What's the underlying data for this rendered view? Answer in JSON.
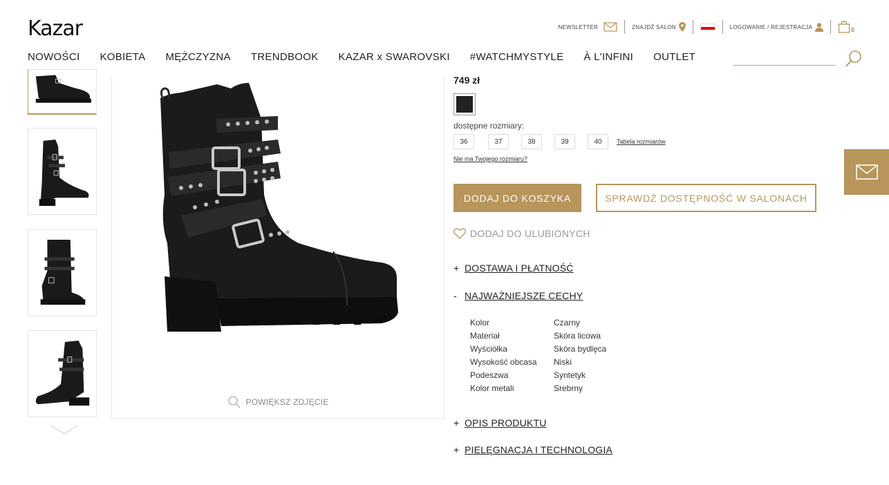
{
  "header": {
    "logo": "Kazar",
    "newsletter": "Newsletter",
    "find_store": "Znajdź salon",
    "login": "Logowanie / Rejestracja",
    "cart_count": "0"
  },
  "nav": {
    "items": [
      "NOWOŚCI",
      "KOBIETA",
      "MĘŻCZYZNA",
      "TRENDBOOK",
      "KAZAR x SWAROVSKI",
      "#WATCHMYSTYLE",
      "À L'INFINI",
      "OUTLET"
    ]
  },
  "gallery": {
    "zoom_label": "POWIĘKSZ ZDJĘCIE"
  },
  "product": {
    "price": "749 zł",
    "color": "#222222",
    "sizes_label": "dostępne rozmiary:",
    "sizes": [
      "36",
      "37",
      "38",
      "39",
      "40"
    ],
    "size_table": "Tabela rozmiarów",
    "no_size": "Nie ma Twojego rozmiaru?",
    "add_to_cart": "DODAJ DO KOSZYKA",
    "check_availability": "SPRAWDŹ DOSTĘPNOŚĆ W SALONACH",
    "add_to_favorites": "DODAJ DO ULUBIONYCH"
  },
  "accordions": [
    {
      "sign": "+",
      "title": "DOSTAWA I PŁATNOŚĆ"
    },
    {
      "sign": "-",
      "title": "NAJWAŻNIEJSZE CECHY"
    },
    {
      "sign": "+",
      "title": "OPIS PRODUKTU"
    },
    {
      "sign": "+",
      "title": "PIELĘGNACJA I TECHNOLOGIA"
    }
  ],
  "features": [
    {
      "key": "Kolor",
      "value": "Czarny"
    },
    {
      "key": "Materiał",
      "value": "Skóra licowa"
    },
    {
      "key": "Wyściółka",
      "value": "Skóra bydlęca"
    },
    {
      "key": "Wysokość obcasa",
      "value": "Niski"
    },
    {
      "key": "Podeszwa",
      "value": "Syntetyk"
    },
    {
      "key": "Kolor metali",
      "value": "Srebrny"
    }
  ],
  "colors": {
    "accent": "#b8955a",
    "flag_red": "#e20613"
  },
  "icons": [
    "mail-icon",
    "map-pin-icon",
    "flag-icon",
    "user-icon",
    "bag-icon",
    "search-icon",
    "heart-icon",
    "chevron-down-icon"
  ]
}
